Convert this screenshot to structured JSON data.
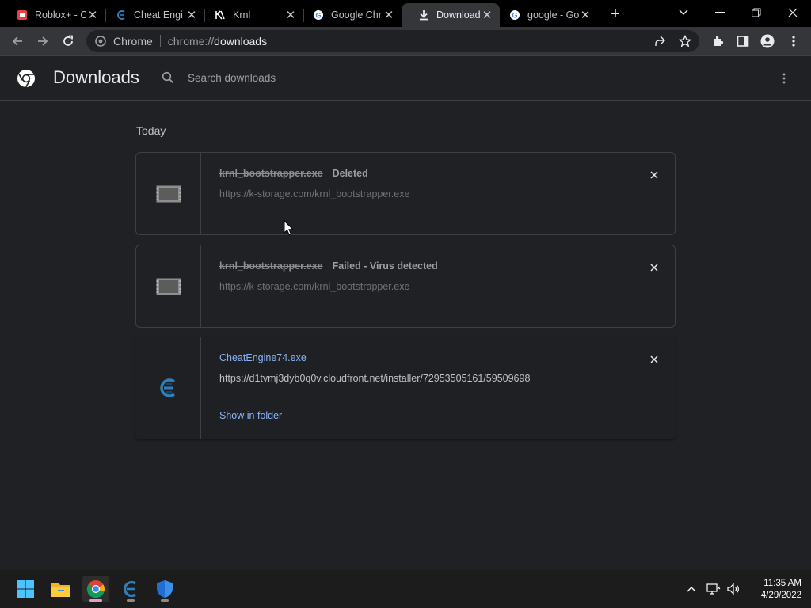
{
  "tabs": [
    {
      "title": "Roblox+ - C",
      "favicon": "roblox-plus-icon",
      "active": false
    },
    {
      "title": "Cheat Engi",
      "favicon": "cheat-engine-icon",
      "active": false
    },
    {
      "title": "Krnl",
      "favicon": "krnl-icon",
      "active": false
    },
    {
      "title": "Google Chr",
      "favicon": "google-icon",
      "active": false
    },
    {
      "title": "Downloads",
      "favicon": "download-icon",
      "active": true
    },
    {
      "title": "google - Go",
      "favicon": "google-icon",
      "active": false
    }
  ],
  "omnibox": {
    "scheme": "Chrome",
    "url_prefix": "chrome://",
    "url_host": "downloads"
  },
  "page": {
    "title": "Downloads",
    "search_placeholder": "Search downloads"
  },
  "section_label": "Today",
  "downloads": [
    {
      "filename": "krnl_bootstrapper.exe",
      "status": "Deleted",
      "url": "https://k-storage.com/krnl_bootstrapper.exe",
      "state": "deleted",
      "icon": "exe-file-icon"
    },
    {
      "filename": "krnl_bootstrapper.exe",
      "status": "Failed - Virus detected",
      "url": "https://k-storage.com/krnl_bootstrapper.exe",
      "state": "failed",
      "icon": "exe-file-icon"
    },
    {
      "filename": "CheatEngine74.exe",
      "status": "",
      "url": "https://d1tvmj3dyb0q0v.cloudfront.net/installer/72953505161/59509698",
      "state": "complete",
      "icon": "cheat-engine-icon",
      "action": "Show in folder"
    }
  ],
  "taskbar": {
    "apps": [
      "start-icon",
      "file-explorer-icon",
      "chrome-icon",
      "cheat-engine-icon",
      "windows-security-icon"
    ],
    "time": "11:35 AM",
    "date": "4/29/2022"
  },
  "colors": {
    "accent": "#8ab4f8",
    "background": "#202124",
    "tabstrip": "#000000",
    "toolbar": "#35363a"
  }
}
